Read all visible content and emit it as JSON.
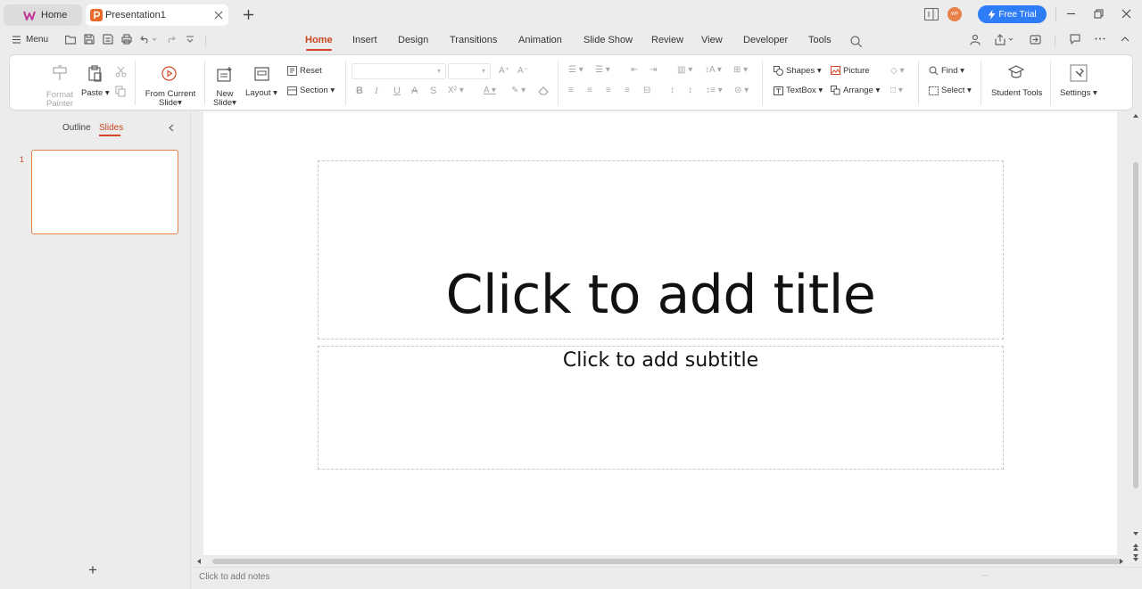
{
  "tabs": {
    "home_label": "Home",
    "doc_label": "Presentation1"
  },
  "titlebar": {
    "free_trial": "Free Trial",
    "avatar_initials": "WP"
  },
  "menu": {
    "label": "Menu",
    "tabs": [
      "Home",
      "Insert",
      "Design",
      "Transitions",
      "Animation",
      "Slide Show",
      "Review",
      "View",
      "Developer",
      "Tools"
    ]
  },
  "ribbon": {
    "format_painter": [
      "Format",
      "Painter"
    ],
    "paste": "Paste",
    "from_current_slide": [
      "From Current",
      "Slide"
    ],
    "new_slide": [
      "New",
      "Slide"
    ],
    "layout": "Layout",
    "reset": "Reset",
    "section": "Section",
    "shapes": "Shapes",
    "picture": "Picture",
    "textbox": "TextBox",
    "arrange": "Arrange",
    "find": "Find",
    "select": "Select",
    "student_tools": "Student Tools",
    "settings": "Settings"
  },
  "left_panel": {
    "outline_tab": "Outline",
    "slides_tab": "Slides",
    "slide_number": "1",
    "add_slide": "+"
  },
  "slide": {
    "title_placeholder": "Click to add title",
    "subtitle_placeholder": "Click to add subtitle"
  },
  "notes": {
    "placeholder": "Click to add notes"
  },
  "colors": {
    "accent": "#d24726",
    "free_trial_bg": "#2f7df6",
    "thumbnail_border": "#e8804a"
  }
}
